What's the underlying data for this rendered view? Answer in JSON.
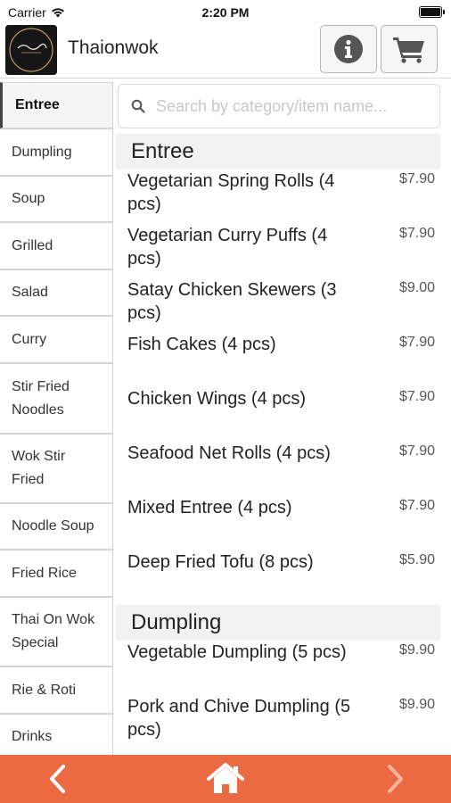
{
  "status_bar": {
    "carrier": "Carrier",
    "time": "2:20 PM"
  },
  "header": {
    "title": "Thaionwok",
    "info_icon": "info-icon",
    "cart_icon": "cart-icon"
  },
  "search": {
    "placeholder": "Search by category/item name..."
  },
  "sidebar": {
    "active": "Entree",
    "items": [
      {
        "label": "Entree"
      },
      {
        "label": "Dumpling"
      },
      {
        "label": "Soup"
      },
      {
        "label": "Grilled"
      },
      {
        "label": "Salad"
      },
      {
        "label": "Curry"
      },
      {
        "label": "Stir Fried Noodles"
      },
      {
        "label": "Wok Stir Fried"
      },
      {
        "label": "Noodle Soup"
      },
      {
        "label": "Fried Rice"
      },
      {
        "label": "Thai On Wok Special"
      },
      {
        "label": "Rie & Roti"
      },
      {
        "label": "Drinks"
      }
    ]
  },
  "menu": {
    "sections": [
      {
        "title": "Entree",
        "items": [
          {
            "name": "Vegetarian Spring Rolls (4 pcs)",
            "price": "$7.90"
          },
          {
            "name": "Vegetarian Curry Puffs (4 pcs)",
            "price": "$7.90"
          },
          {
            "name": "Satay Chicken Skewers (3 pcs)",
            "price": "$9.00"
          },
          {
            "name": "Fish Cakes (4 pcs)",
            "price": "$7.90"
          },
          {
            "name": "Chicken Wings (4 pcs)",
            "price": "$7.90"
          },
          {
            "name": "Seafood Net Rolls (4 pcs)",
            "price": "$7.90"
          },
          {
            "name": "Mixed Entree (4 pcs)",
            "price": "$7.90"
          },
          {
            "name": "Deep Fried Tofu (8 pcs)",
            "price": "$5.90"
          }
        ]
      },
      {
        "title": "Dumpling",
        "items": [
          {
            "name": "Vegetable Dumpling (5 pcs)",
            "price": "$9.90"
          },
          {
            "name": "Pork and Chive Dumpling (5 pcs)",
            "price": "$9.90"
          }
        ]
      }
    ]
  },
  "bottom_bar": {
    "color": "#ec6a42",
    "back_icon": "chevron-left-icon",
    "home_icon": "home-icon",
    "forward_icon": "chevron-right-icon"
  }
}
